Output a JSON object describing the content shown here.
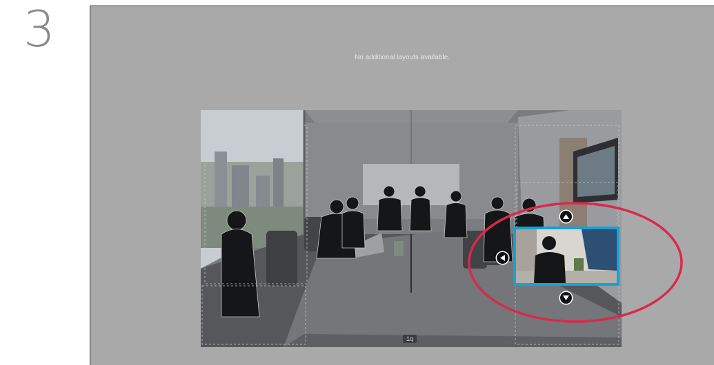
{
  "step": {
    "number": "3"
  },
  "screen": {
    "message": "No additional layouts available."
  },
  "video": {
    "participant_label": "1q"
  },
  "self_view": {
    "move_up_icon": "triangle-up-icon",
    "move_down_icon": "triangle-down-icon",
    "move_left_icon": "triangle-left-icon"
  },
  "colors": {
    "screen_background": "#a9a9a9",
    "selection_border": "#11a3da",
    "annotation_ring": "#d9294e"
  }
}
